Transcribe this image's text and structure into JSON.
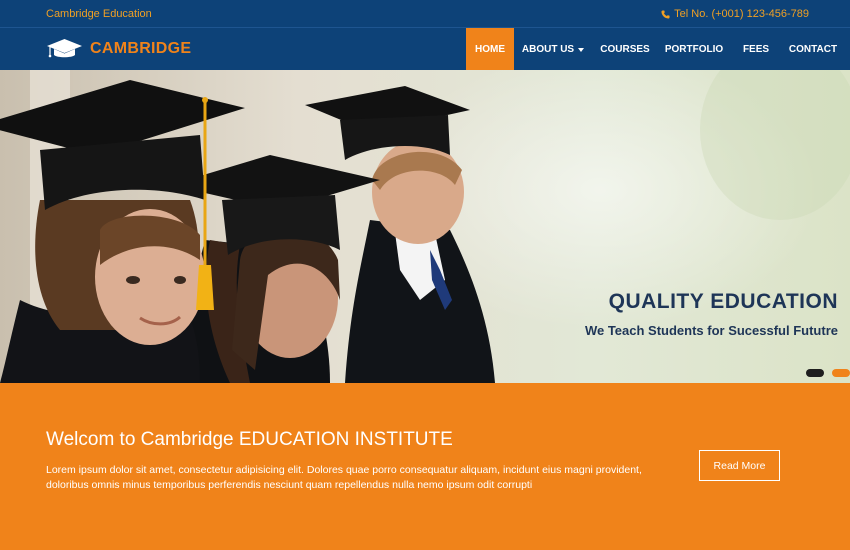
{
  "topbar": {
    "brand": "Cambridge Education",
    "phone": "Tel No. (+001) 123-456-789",
    "phone_icon": "phone-icon"
  },
  "header": {
    "logo_text": "CAMBRIDGE",
    "logo_icon": "graduation-cap-icon"
  },
  "nav": {
    "items": [
      {
        "label": "HOME",
        "active": true
      },
      {
        "label": "ABOUT US",
        "dropdown": true
      },
      {
        "label": "COURSES"
      },
      {
        "label": "PORTFOLIO"
      },
      {
        "label": "FEES"
      },
      {
        "label": "CONTACT"
      }
    ]
  },
  "hero": {
    "title": "QUALITY EDUCATION",
    "subtitle": "We Teach Students for Sucessful Fututre",
    "slides": 2,
    "active_slide": 1
  },
  "welcome": {
    "heading": "Welcom to Cambridge EDUCATION INSTITUTE",
    "body": "Lorem ipsum dolor sit amet, consectetur adipisicing elit. Dolores quae porro consequatur aliquam, incidunt eius magni provident, doloribus omnis minus temporibus perferendis nesciunt quam repellendus nulla nemo ipsum odit corrupti",
    "button": "Read More"
  },
  "colors": {
    "navy": "#0d4278",
    "orange": "#f0831a",
    "gold": "#f0a024",
    "hero_text": "#1e3557"
  }
}
